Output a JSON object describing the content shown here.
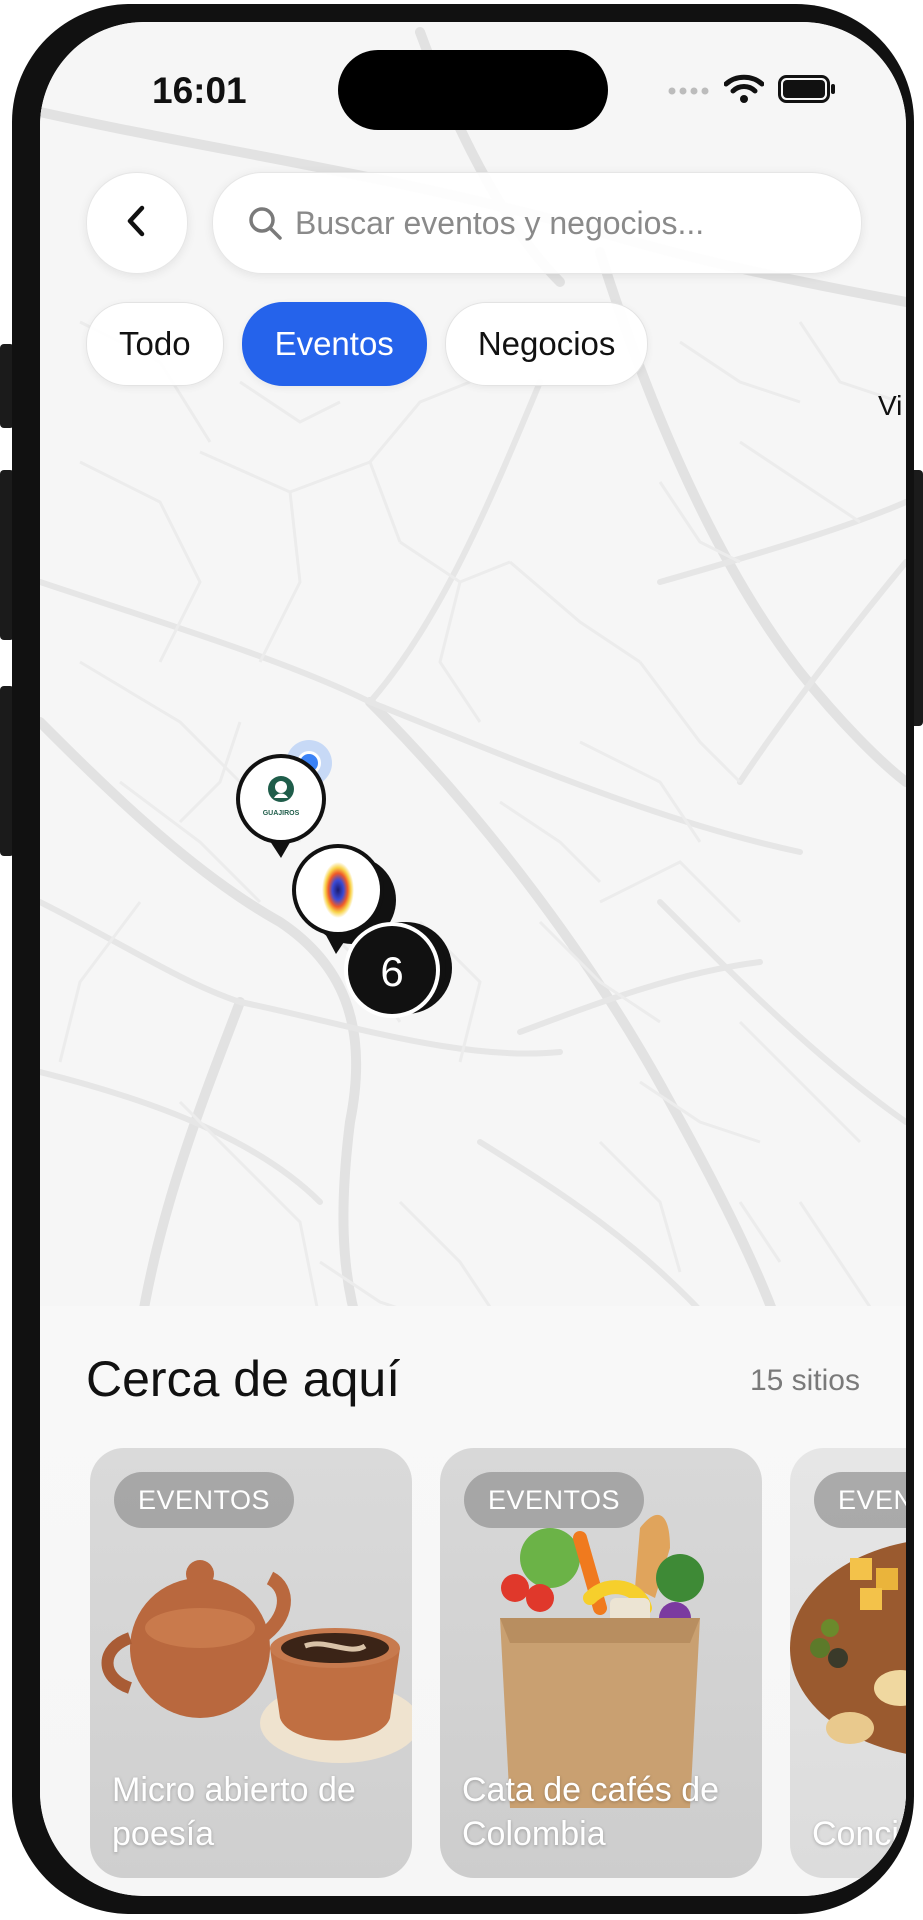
{
  "status_bar": {
    "time": "16:01"
  },
  "header": {
    "back_icon": "chevron-left-icon",
    "search_icon": "search-icon",
    "search_placeholder": "Buscar eventos y negocios..."
  },
  "filters": {
    "items": [
      {
        "label": "Todo",
        "active": false
      },
      {
        "label": "Eventos",
        "active": true
      },
      {
        "label": "Negocios",
        "active": false
      }
    ]
  },
  "map": {
    "place_label": "Vi",
    "pins": [
      {
        "type": "business-logo",
        "name": "GUAJIROS"
      },
      {
        "type": "event-gradient"
      },
      {
        "type": "cluster",
        "count": "6"
      }
    ]
  },
  "nearby": {
    "title": "Cerca de aquí",
    "count": "15 sitios",
    "cards": [
      {
        "category": "EVENTOS",
        "title": "Micro abierto de poesía",
        "image": "clay-teapot-and-coffee-cup"
      },
      {
        "category": "EVENTOS",
        "title": "Cata de cafés de Colombia",
        "image": "grocery-bag-with-vegetables"
      },
      {
        "category": "EVENTOS",
        "title": "Concierto acústico",
        "image": "cheese-and-olives-board"
      }
    ]
  },
  "colors": {
    "accent": "#2563eb",
    "cluster": "#111111",
    "user_location": "#3b82f6"
  }
}
